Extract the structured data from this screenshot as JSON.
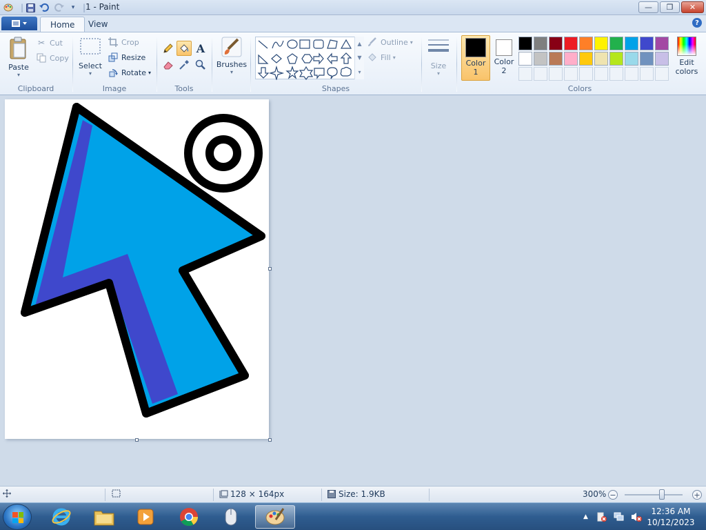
{
  "window": {
    "title": "1 - Paint",
    "min_glyph": "—",
    "max_glyph": "❐",
    "close_glyph": "✕"
  },
  "tabs": [
    {
      "label": "Home",
      "active": true
    },
    {
      "label": "View",
      "active": false
    }
  ],
  "help_glyph": "?",
  "clipboard": {
    "group_label": "Clipboard",
    "paste": "Paste",
    "cut": "Cut",
    "copy": "Copy"
  },
  "image": {
    "group_label": "Image",
    "select": "Select",
    "crop": "Crop",
    "resize": "Resize",
    "rotate": "Rotate"
  },
  "tools": {
    "group_label": "Tools",
    "items": [
      "pencil-icon",
      "fill-bucket-icon",
      "text-icon",
      "eraser-icon",
      "color-picker-icon",
      "magnifier-icon"
    ],
    "selected": "fill-bucket-icon"
  },
  "brushes": {
    "label": "Brushes"
  },
  "shapes": {
    "group_label": "Shapes",
    "outline": "Outline",
    "fill": "Fill"
  },
  "size": {
    "label": "Size"
  },
  "colors": {
    "group_label": "Colors",
    "color1": {
      "label_line1": "Color",
      "label_line2": "1",
      "value": "#000000"
    },
    "color2": {
      "label_line1": "Color",
      "label_line2": "2",
      "value": "#ffffff"
    },
    "edit_line1": "Edit",
    "edit_line2": "colors",
    "palette_row1": [
      "#000000",
      "#7f7f7f",
      "#880015",
      "#ed1c24",
      "#ff7f27",
      "#fff200",
      "#22b14c",
      "#00a2e8",
      "#3f48cc",
      "#a349a4"
    ],
    "palette_row2": [
      "#ffffff",
      "#c3c3c3",
      "#b97a57",
      "#ffaec9",
      "#ffc90e",
      "#efe4b0",
      "#b5e61d",
      "#99d9ea",
      "#7092be",
      "#c8bfe7"
    ]
  },
  "status": {
    "dimensions": "128 × 164px",
    "size": "Size: 1.9KB",
    "zoom": "300%"
  },
  "clock": {
    "time": "12:36 AM",
    "date": "10/12/2023"
  },
  "drawing": {
    "arrow_fill": "#00a2e8",
    "arrow_shade": "#3f48cc",
    "outline": "#000000"
  }
}
